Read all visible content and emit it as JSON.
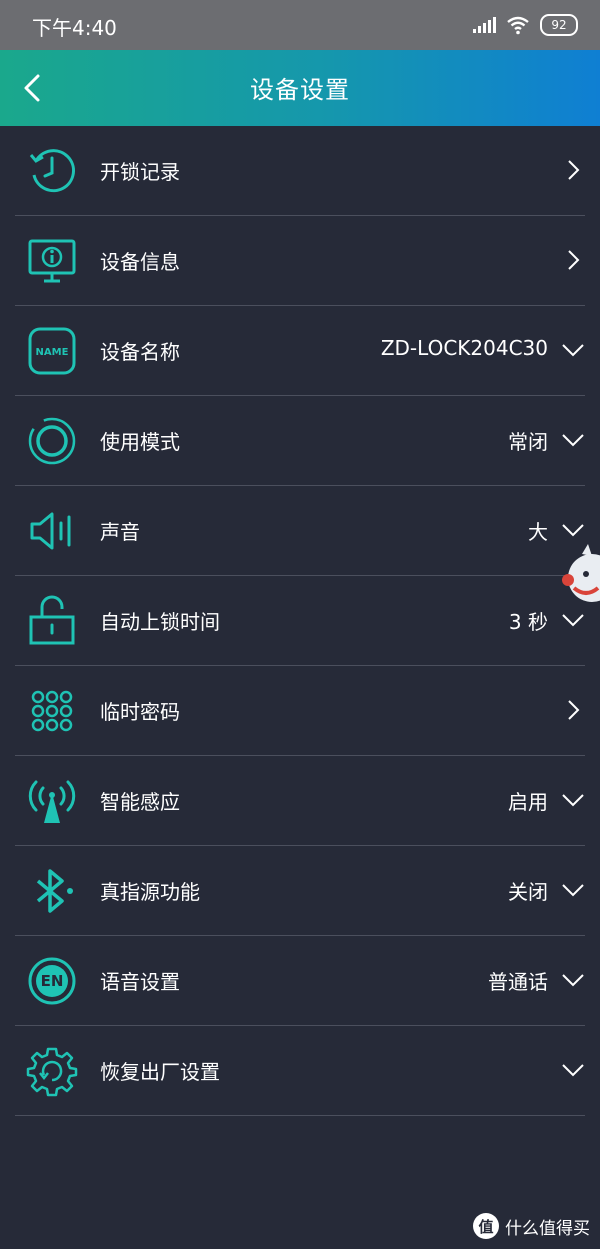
{
  "status_bar": {
    "time": "下午4:40",
    "battery": "92"
  },
  "header": {
    "title": "设备设置"
  },
  "colors": {
    "accent": "#1fc3b4",
    "background": "#262a38",
    "header_start": "#1aa88c",
    "header_end": "#0f7fd3"
  },
  "settings": [
    {
      "label": "开锁记录",
      "value": "",
      "icon": "unlock-history-icon",
      "action": "chevron-right"
    },
    {
      "label": "设备信息",
      "value": "",
      "icon": "device-info-icon",
      "action": "chevron-right"
    },
    {
      "label": "设备名称",
      "value": "ZD-LOCK204C30",
      "icon": "name-tag-icon",
      "action": "chevron-down"
    },
    {
      "label": "使用模式",
      "value": "常闭",
      "icon": "mode-ring-icon",
      "action": "chevron-down"
    },
    {
      "label": "声音",
      "value": "大",
      "icon": "speaker-icon",
      "action": "chevron-down"
    },
    {
      "label": "自动上锁时间",
      "value": "3 秒",
      "icon": "padlock-icon",
      "action": "chevron-down"
    },
    {
      "label": "临时密码",
      "value": "",
      "icon": "keypad-icon",
      "action": "chevron-right"
    },
    {
      "label": "智能感应",
      "value": "启用",
      "icon": "sensor-antenna-icon",
      "action": "chevron-down"
    },
    {
      "label": "真指源功能",
      "value": "关闭",
      "icon": "bluetooth-icon",
      "action": "chevron-down"
    },
    {
      "label": "语音设置",
      "value": "普通话",
      "icon": "language-en-icon",
      "action": "chevron-down"
    },
    {
      "label": "恢复出厂设置",
      "value": "",
      "icon": "factory-reset-gear-icon",
      "action": "chevron-down"
    }
  ],
  "watermark": {
    "badge": "值",
    "text": "什么值得买"
  }
}
